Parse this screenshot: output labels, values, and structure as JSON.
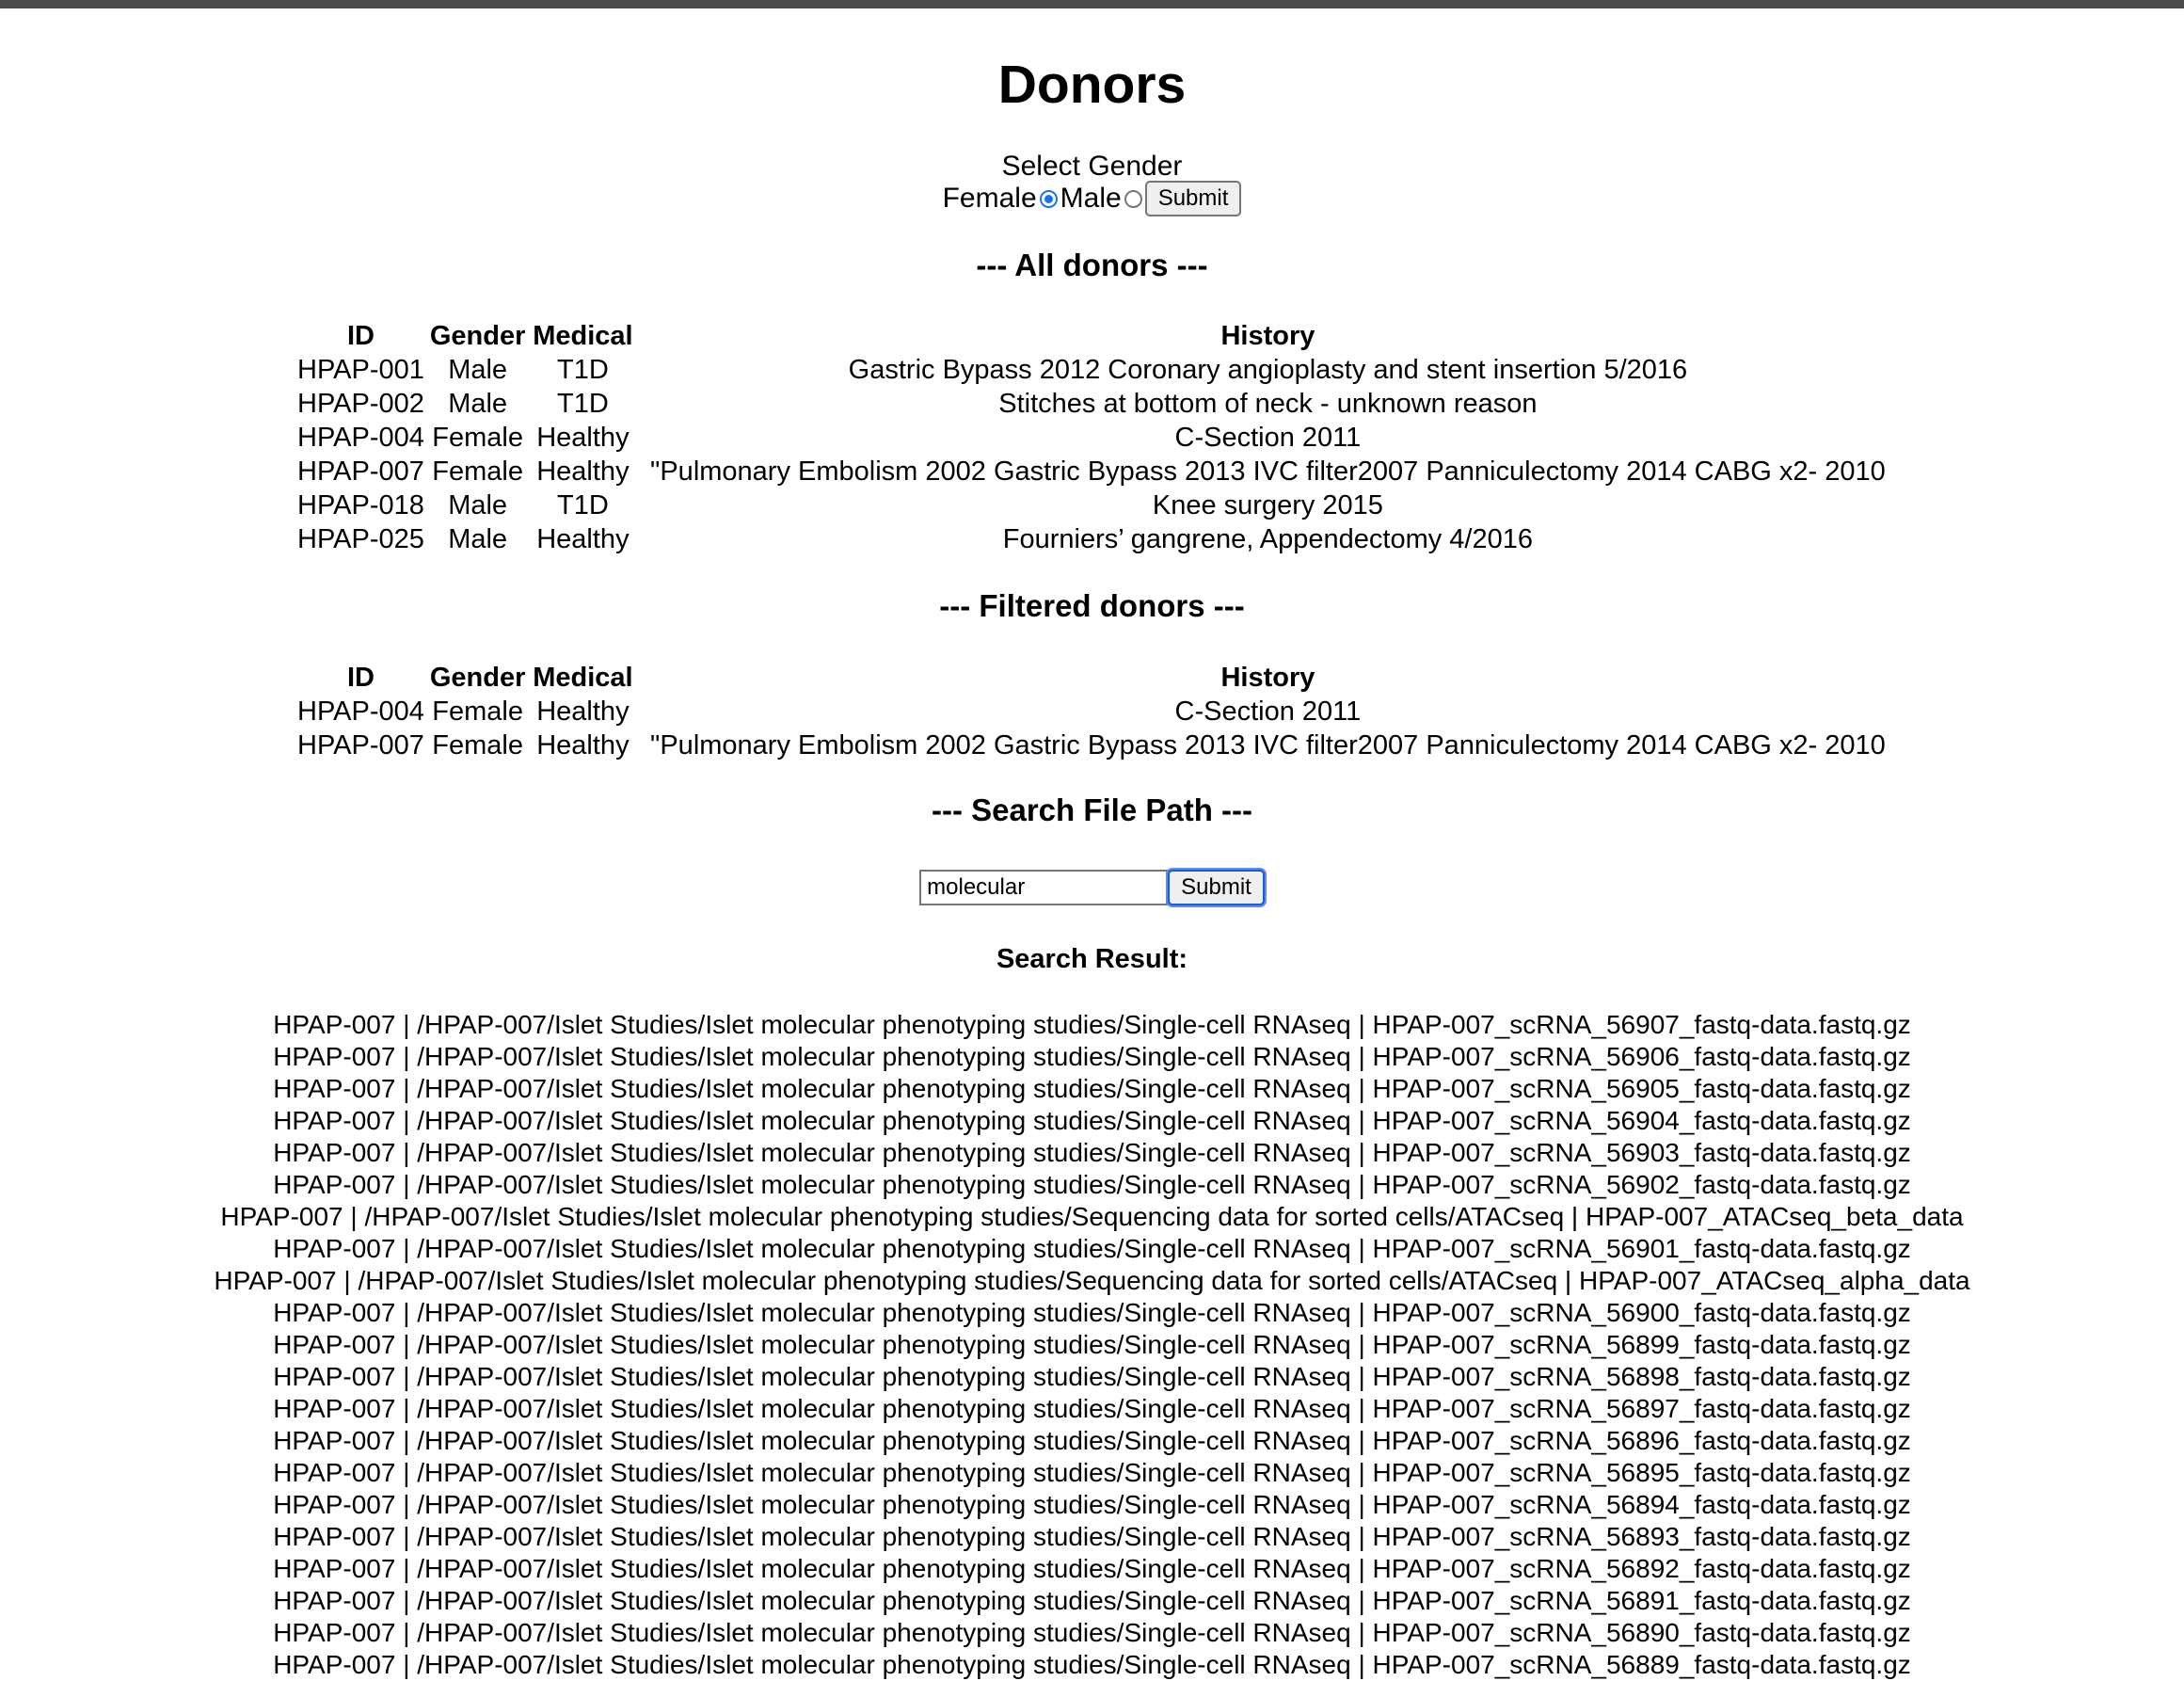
{
  "page": {
    "title": "Donors",
    "gender_prompt": "Select Gender",
    "gender_options": [
      "Female",
      "Male"
    ],
    "gender_selected": "Female",
    "submit_label": "Submit",
    "all_donors_heading": "--- All donors ---",
    "filtered_donors_heading": "--- Filtered donors ---",
    "search_heading": "--- Search File Path ---",
    "search_value": "molecular",
    "search_result_label": "Search Result:"
  },
  "table_headers": [
    "ID",
    "Gender",
    "Medical",
    "History"
  ],
  "all_donors": [
    [
      "HPAP-001",
      "Male",
      "T1D",
      "Gastric Bypass 2012 Coronary angioplasty and stent insertion 5/2016"
    ],
    [
      "HPAP-002",
      "Male",
      "T1D",
      "Stitches at bottom of neck - unknown reason"
    ],
    [
      "HPAP-004",
      "Female",
      "Healthy",
      "C-Section 2011"
    ],
    [
      "HPAP-007",
      "Female",
      "Healthy",
      "\"Pulmonary Embolism 2002 Gastric Bypass 2013 IVC filter2007 Panniculectomy 2014 CABG x2- 2010"
    ],
    [
      "HPAP-018",
      "Male",
      "T1D",
      "Knee surgery 2015"
    ],
    [
      "HPAP-025",
      "Male",
      "Healthy",
      "Fourniers’ gangrene, Appendectomy 4/2016"
    ]
  ],
  "filtered_donors": [
    [
      "HPAP-004",
      "Female",
      "Healthy",
      "C-Section 2011"
    ],
    [
      "HPAP-007",
      "Female",
      "Healthy",
      "\"Pulmonary Embolism 2002 Gastric Bypass 2013 IVC filter2007 Panniculectomy 2014 CABG x2- 2010"
    ]
  ],
  "search_results": [
    "HPAP-007 | /HPAP-007/Islet Studies/Islet molecular phenotyping studies/Single-cell RNAseq | HPAP-007_scRNA_56907_fastq-data.fastq.gz",
    "HPAP-007 | /HPAP-007/Islet Studies/Islet molecular phenotyping studies/Single-cell RNAseq | HPAP-007_scRNA_56906_fastq-data.fastq.gz",
    "HPAP-007 | /HPAP-007/Islet Studies/Islet molecular phenotyping studies/Single-cell RNAseq | HPAP-007_scRNA_56905_fastq-data.fastq.gz",
    "HPAP-007 | /HPAP-007/Islet Studies/Islet molecular phenotyping studies/Single-cell RNAseq | HPAP-007_scRNA_56904_fastq-data.fastq.gz",
    "HPAP-007 | /HPAP-007/Islet Studies/Islet molecular phenotyping studies/Single-cell RNAseq | HPAP-007_scRNA_56903_fastq-data.fastq.gz",
    "HPAP-007 | /HPAP-007/Islet Studies/Islet molecular phenotyping studies/Single-cell RNAseq | HPAP-007_scRNA_56902_fastq-data.fastq.gz",
    "HPAP-007 | /HPAP-007/Islet Studies/Islet molecular phenotyping studies/Sequencing data for sorted cells/ATACseq | HPAP-007_ATACseq_beta_data",
    "HPAP-007 | /HPAP-007/Islet Studies/Islet molecular phenotyping studies/Single-cell RNAseq | HPAP-007_scRNA_56901_fastq-data.fastq.gz",
    "HPAP-007 | /HPAP-007/Islet Studies/Islet molecular phenotyping studies/Sequencing data for sorted cells/ATACseq | HPAP-007_ATACseq_alpha_data",
    "HPAP-007 | /HPAP-007/Islet Studies/Islet molecular phenotyping studies/Single-cell RNAseq | HPAP-007_scRNA_56900_fastq-data.fastq.gz",
    "HPAP-007 | /HPAP-007/Islet Studies/Islet molecular phenotyping studies/Single-cell RNAseq | HPAP-007_scRNA_56899_fastq-data.fastq.gz",
    "HPAP-007 | /HPAP-007/Islet Studies/Islet molecular phenotyping studies/Single-cell RNAseq | HPAP-007_scRNA_56898_fastq-data.fastq.gz",
    "HPAP-007 | /HPAP-007/Islet Studies/Islet molecular phenotyping studies/Single-cell RNAseq | HPAP-007_scRNA_56897_fastq-data.fastq.gz",
    "HPAP-007 | /HPAP-007/Islet Studies/Islet molecular phenotyping studies/Single-cell RNAseq | HPAP-007_scRNA_56896_fastq-data.fastq.gz",
    "HPAP-007 | /HPAP-007/Islet Studies/Islet molecular phenotyping studies/Single-cell RNAseq | HPAP-007_scRNA_56895_fastq-data.fastq.gz",
    "HPAP-007 | /HPAP-007/Islet Studies/Islet molecular phenotyping studies/Single-cell RNAseq | HPAP-007_scRNA_56894_fastq-data.fastq.gz",
    "HPAP-007 | /HPAP-007/Islet Studies/Islet molecular phenotyping studies/Single-cell RNAseq | HPAP-007_scRNA_56893_fastq-data.fastq.gz",
    "HPAP-007 | /HPAP-007/Islet Studies/Islet molecular phenotyping studies/Single-cell RNAseq | HPAP-007_scRNA_56892_fastq-data.fastq.gz",
    "HPAP-007 | /HPAP-007/Islet Studies/Islet molecular phenotyping studies/Single-cell RNAseq | HPAP-007_scRNA_56891_fastq-data.fastq.gz",
    "HPAP-007 | /HPAP-007/Islet Studies/Islet molecular phenotyping studies/Single-cell RNAseq | HPAP-007_scRNA_56890_fastq-data.fastq.gz",
    "HPAP-007 | /HPAP-007/Islet Studies/Islet molecular phenotyping studies/Single-cell RNAseq | HPAP-007_scRNA_56889_fastq-data.fastq.gz"
  ]
}
